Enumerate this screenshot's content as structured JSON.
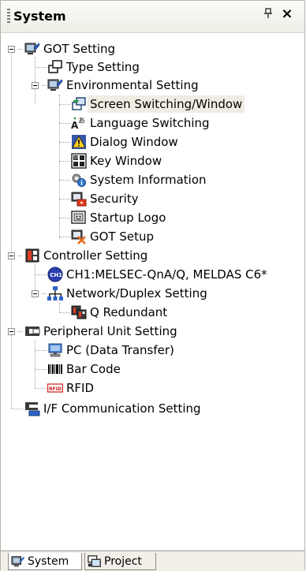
{
  "panel": {
    "title": "System",
    "pin": "⊥",
    "close": "×"
  },
  "tree": {
    "got_setting": "GOT Setting",
    "type_setting": "Type Setting",
    "environmental_setting": "Environmental Setting",
    "screen_switching": "Screen Switching/Window",
    "language_switching": "Language Switching",
    "dialog_window": "Dialog Window",
    "key_window": "Key Window",
    "system_information": "System Information",
    "security": "Security",
    "startup_logo": "Startup Logo",
    "got_setup": "GOT Setup",
    "controller_setting": "Controller Setting",
    "ch1": "CH1:MELSEC-QnA/Q, MELDAS C6*",
    "network_duplex": "Network/Duplex Setting",
    "q_redundant": "Q Redundant",
    "peripheral_unit": "Peripheral Unit Setting",
    "pc_data_transfer": "PC (Data Transfer)",
    "bar_code": "Bar Code",
    "rfid": "RFID",
    "if_communication": "I/F Communication Setting"
  },
  "icons": {
    "ch1_badge": "CH1",
    "rfid_badge": "RFID",
    "key_digits": "55"
  },
  "tabs": {
    "system": "System",
    "project": "Project"
  },
  "colors": {
    "selection": "#f0ece1",
    "panel_border": "#b6b3ab"
  }
}
